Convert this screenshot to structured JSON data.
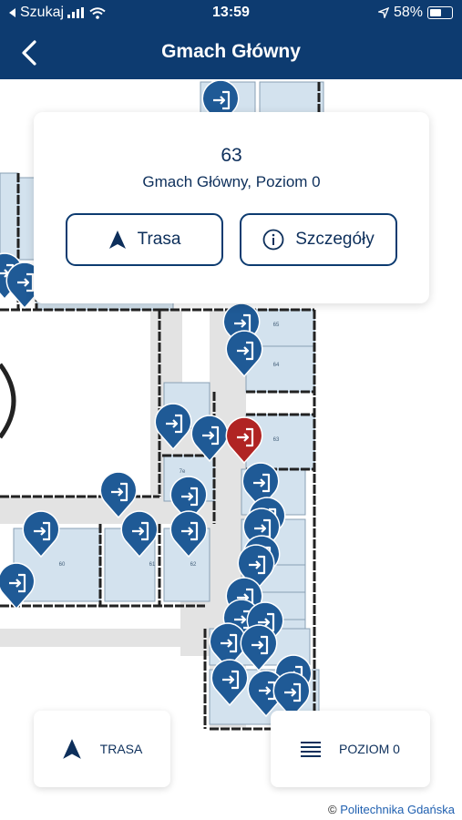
{
  "status_bar": {
    "carrier": "Szukaj",
    "time": "13:59",
    "battery": "58%",
    "battery_level": 0.58
  },
  "nav": {
    "title": "Gmach Główny",
    "back_icon": "chevron-left-icon"
  },
  "map": {
    "pin_icon": "door-exit-icon",
    "pin_color": "#1f5a96",
    "selected_pin_color": "#b02423",
    "room_fill": "#d3e2ee",
    "corridor_fill": "#e3e3e3",
    "wall_color": "#222222",
    "room_labels": [
      "65",
      "64",
      "63",
      "7e",
      "61",
      "62",
      "60"
    ]
  },
  "info_card": {
    "room_number": "63",
    "location": "Gmach Główny, Poziom 0",
    "route_button": "Trasa",
    "details_button": "Szczegóły"
  },
  "bottom": {
    "route_button": "TRASA",
    "level_button": "POZIOM 0"
  },
  "attribution": {
    "symbol": "©",
    "text": "Politechnika Gdańska"
  },
  "colors": {
    "header": "#0d3b70",
    "accent_text": "#0d2f5b",
    "attribution_link": "#2060b0"
  }
}
